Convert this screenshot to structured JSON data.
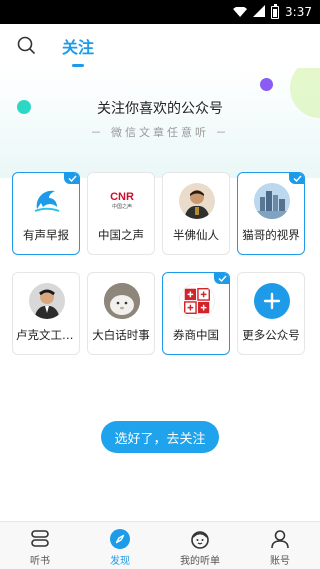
{
  "status_bar": {
    "time": "3:37"
  },
  "header": {
    "tab_label": "关注"
  },
  "hero": {
    "title": "关注你喜欢的公众号",
    "subtitle": "－ 微信文章任意听 －"
  },
  "accounts": [
    {
      "name": "有声早报",
      "selected": true,
      "icon": "dolphin-logo-icon"
    },
    {
      "name": "中国之声",
      "selected": false,
      "icon": "cnr-logo-icon",
      "logo_text": "CNR",
      "logo_sub": "中国之声"
    },
    {
      "name": "半佛仙人",
      "selected": false,
      "icon": "person-avatar-icon"
    },
    {
      "name": "猫哥的视界",
      "selected": true,
      "icon": "city-avatar-icon"
    },
    {
      "name": "卢克文工作室",
      "selected": false,
      "icon": "person-avatar-icon"
    },
    {
      "name": "大白话时事",
      "selected": false,
      "icon": "animal-avatar-icon"
    },
    {
      "name": "券商中国",
      "selected": true,
      "icon": "seal-logo-icon"
    },
    {
      "name": "更多公众号",
      "selected": false,
      "icon": "plus-icon"
    }
  ],
  "cta": {
    "label": "选好了，去关注"
  },
  "bottom_nav": [
    {
      "label": "听书",
      "icon": "book-icon",
      "active": false
    },
    {
      "label": "发现",
      "icon": "compass-icon",
      "active": true
    },
    {
      "label": "我的听单",
      "icon": "face-icon",
      "active": false
    },
    {
      "label": "账号",
      "icon": "user-icon",
      "active": false
    }
  ],
  "colors": {
    "accent": "#1e9be8",
    "cta": "#1fa3ec"
  }
}
